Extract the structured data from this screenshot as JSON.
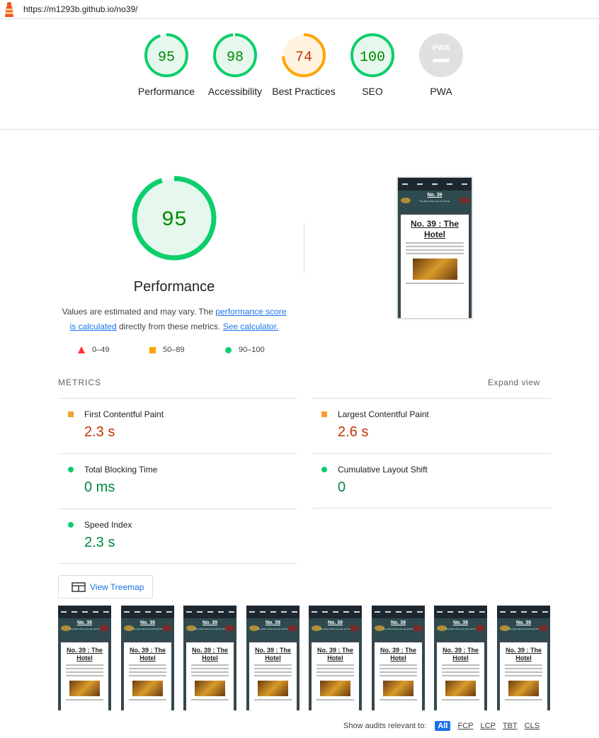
{
  "url": "https://m1293b.github.io/no39/",
  "categories": [
    {
      "label": "Performance",
      "score": "95",
      "value": 95,
      "color": "#0cce6b",
      "text": "#008800",
      "bg": "#e6f8ee"
    },
    {
      "label": "Accessibility",
      "score": "98",
      "value": 98,
      "color": "#0cce6b",
      "text": "#008800",
      "bg": "#e6f8ee"
    },
    {
      "label": "Best Practices",
      "score": "74",
      "value": 74,
      "color": "#ffa400",
      "text": "#c33300",
      "bg": "#fff3e0"
    },
    {
      "label": "SEO",
      "score": "100",
      "value": 100,
      "color": "#0cce6b",
      "text": "#008800",
      "bg": "#e6f8ee"
    },
    {
      "label": "PWA",
      "score": "PWA",
      "value": 0,
      "color": "#cccccc",
      "text": "#ffffff",
      "bg": "#e0e0e0"
    }
  ],
  "performance": {
    "score": "95",
    "value": 95,
    "title": "Performance",
    "desc_prefix": "Values are estimated and may vary. The ",
    "desc_link1": "performance score is calculated",
    "desc_mid": " directly from these metrics. ",
    "desc_link2": "See calculator."
  },
  "legend": {
    "fail": "0–49",
    "average": "50–89",
    "pass": "90–100"
  },
  "metrics_header": "METRICS",
  "expand_view": "Expand view",
  "metrics": [
    {
      "name": "First Contentful Paint",
      "value": "2.3 s",
      "status": "average"
    },
    {
      "name": "Largest Contentful Paint",
      "value": "2.6 s",
      "status": "average"
    },
    {
      "name": "Total Blocking Time",
      "value": "0 ms",
      "status": "pass"
    },
    {
      "name": "Cumulative Layout Shift",
      "value": "0",
      "status": "pass"
    },
    {
      "name": "Speed Index",
      "value": "2.3 s",
      "status": "pass"
    }
  ],
  "treemap_label": "View Treemap",
  "screenshot": {
    "banner_title": "No. 39",
    "banner_sub": "The place where you can just be.",
    "heading": "No. 39 : The Hotel"
  },
  "filmstrip_count": 8,
  "audits_filter": {
    "label": "Show audits relevant to:",
    "chips": [
      "All",
      "FCP",
      "LCP",
      "TBT",
      "CLS"
    ]
  }
}
